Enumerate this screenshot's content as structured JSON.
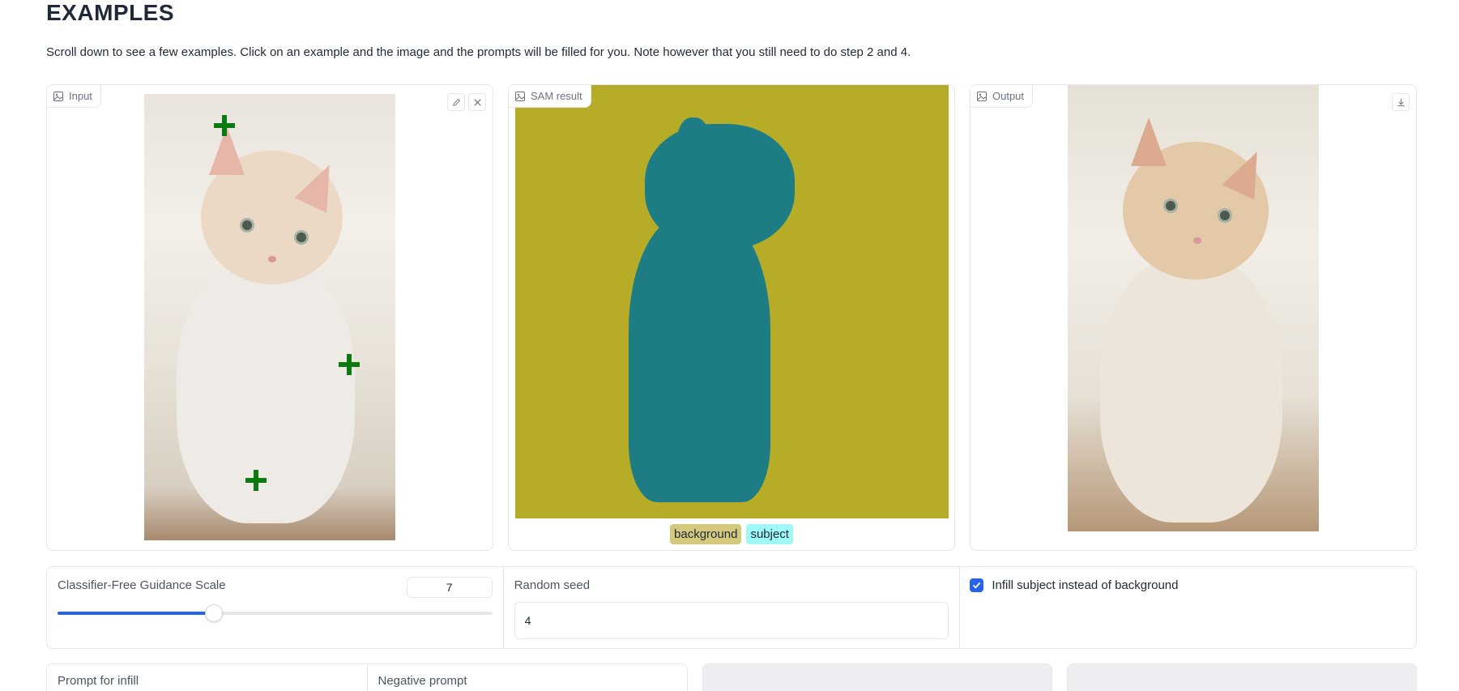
{
  "header": {
    "title": "EXAMPLES",
    "description": "Scroll down to see a few examples. Click on an example and the image and the prompts will be filled for you. Note however that you still need to do step 2 and 4."
  },
  "panels": {
    "input": {
      "label": "Input",
      "edit_icon": "pencil-icon",
      "clear_icon": "close-icon",
      "point_count": 3
    },
    "sam": {
      "label": "SAM result",
      "legend": [
        "background",
        "subject"
      ],
      "colors": {
        "background": "#b7ac28",
        "subject": "#1e7d84"
      }
    },
    "output": {
      "label": "Output",
      "download_icon": "download-icon"
    }
  },
  "controls": {
    "guidance": {
      "label": "Classifier-Free Guidance Scale",
      "value": "7",
      "fraction": 0.36
    },
    "seed": {
      "label": "Random seed",
      "value": "4"
    },
    "infill": {
      "label": "Infill subject instead of background",
      "checked": true
    }
  },
  "prompts": {
    "infill_label": "Prompt for infill",
    "negative_label": "Negative prompt"
  },
  "accent": "#2563eb"
}
